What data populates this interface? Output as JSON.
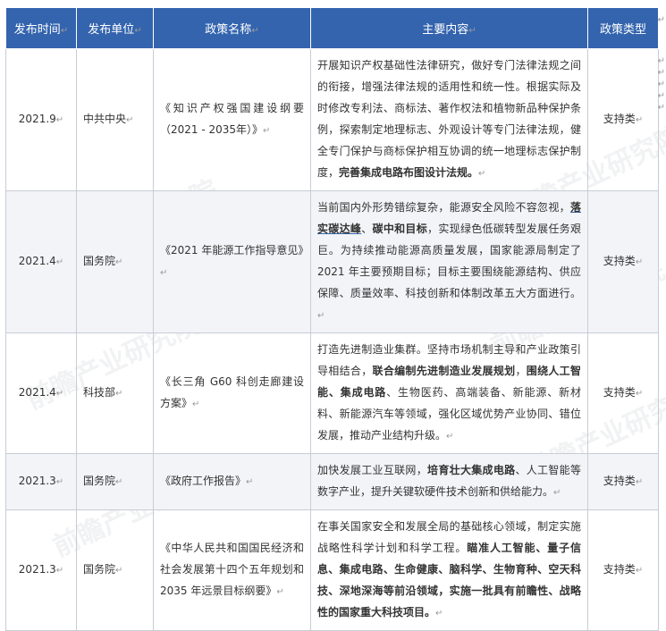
{
  "mark": "↵",
  "watermark": "前瞻产业研究院",
  "headers": [
    "发布时间",
    "发布单位",
    "政策名称",
    "主要内容",
    "政策类型"
  ],
  "rows": [
    {
      "date": "2021.9",
      "unit": "中共中央",
      "name": "《知识产权强国建设纲要（2021 - 2035年）》",
      "content": [
        {
          "t": "开展知识产权基础性法律研究，做好专门法律法规之间的衔接，增强法律法规的适用性和统一性。根据实际及时修改专利法、商标法、著作权法和植物新品种保护条例，探索制定地理标志、外观设计等专门法律法规，健全专门保护与商标保护相互协调的统一地理标志保护制度，"
        },
        {
          "t": "完善集成电路布图设计法规。",
          "b": true
        }
      ],
      "type": "支持类"
    },
    {
      "date": "2021.4",
      "unit": "国务院",
      "name": "《2021 年能源工作指导意见》",
      "content": [
        {
          "t": "当前国内外形势错综复杂，能源安全风险不容忽视，"
        },
        {
          "t": "落实碳达峰",
          "b": true,
          "u": true
        },
        {
          "t": "、"
        },
        {
          "t": "碳中和目标",
          "b": true
        },
        {
          "t": "，实现绿色低碳转型发展任务艰巨。为持续推动能源高质量发展，国家能源局制定了 2021 年主要预期目标；目标主要围绕能源结构、供应保障、质量效率、科技创新和体制改革五大方面进行。"
        }
      ],
      "type": "支持类"
    },
    {
      "date": "2021.4",
      "unit": "科技部",
      "name": "《长三角 G60 科创走廊建设方案》",
      "content": [
        {
          "t": "打造先进制造业集群。坚持市场机制主导和产业政策引导相结合，"
        },
        {
          "t": "联合编制先进制造业发展规划",
          "b": true
        },
        {
          "t": "，"
        },
        {
          "t": "围绕人工智能、集成电路",
          "b": true
        },
        {
          "t": "、生物医药、高端装备、新能源、新材料、新能源汽车等领域，强化区域优势产业协同、错位发展，推动产业结构升级。"
        }
      ],
      "type": "支持类"
    },
    {
      "date": "2021.3",
      "unit": "国务院",
      "name": "《政府工作报告》",
      "content": [
        {
          "t": "加快发展工业互联网，"
        },
        {
          "t": "培育壮大集成电路",
          "b": true
        },
        {
          "t": "、人工智能等数字产业，提升关键软硬件技术创新和供给能力。"
        }
      ],
      "type": "支持类"
    },
    {
      "date": "2021.3",
      "unit": "国务院",
      "name": "《中华人民共和国国民经济和社会发展第十四个五年规划和 2035 年远景目标纲要》",
      "content": [
        {
          "t": "在事关国家安全和发展全局的基础核心领域，制定实施战略性科学计划和科学工程。"
        },
        {
          "t": "瞄准人工智能、量子信息、集成电路、生命健康、脑科学、生物育种、空天科技、深地深海等前沿领域，实施一批具有前瞻性、战略性的国家重大科技项目。",
          "b": true
        }
      ],
      "type": "支持类"
    }
  ]
}
